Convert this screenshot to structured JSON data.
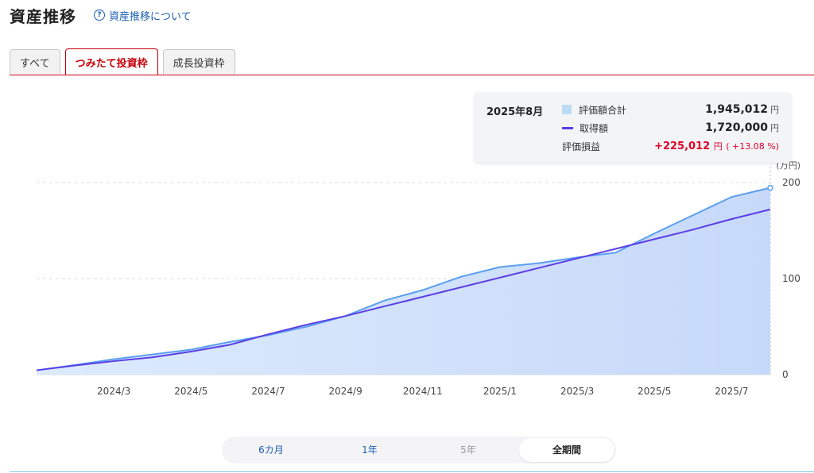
{
  "header": {
    "title": "資産推移",
    "help_link": "資産推移について",
    "help_icon": "question-circle-icon"
  },
  "tabs": [
    {
      "label": "すべて",
      "active": false
    },
    {
      "label": "つみたて投資枠",
      "active": true
    },
    {
      "label": "成長投資枠",
      "active": false
    }
  ],
  "tooltip": {
    "month": "2025年8月",
    "valuation_label": "評価額合計",
    "valuation_value": "1,945,012",
    "cost_label": "取得額",
    "cost_value": "1,720,000",
    "pnl_label": "評価損益",
    "pnl_value": "+225,012",
    "pnl_pct": "( +13.08 %)",
    "unit": "円"
  },
  "range": {
    "options": [
      "6カ月",
      "1年",
      "5年",
      "全期間"
    ],
    "active_index": 3,
    "disabled_index": 2
  },
  "colors": {
    "area_fill": "#cfe4fb",
    "valuation_line": "#5a9ef0",
    "cost_line": "#5b3ee6",
    "positive": "#e0002a",
    "accent": "#c7000b"
  },
  "chart_data": {
    "type": "area",
    "y_unit": "(万円)",
    "ylim": [
      0,
      200
    ],
    "y_ticks": [
      0,
      100,
      200
    ],
    "x_tick_labels": [
      "2024/3",
      "2024/5",
      "2024/7",
      "2024/9",
      "2024/11",
      "2025/1",
      "2025/3",
      "2025/5",
      "2025/7"
    ],
    "x": [
      "2024/1",
      "2024/2",
      "2024/3",
      "2024/4",
      "2024/5",
      "2024/6",
      "2024/7",
      "2024/8",
      "2024/9",
      "2024/10",
      "2024/11",
      "2024/12",
      "2025/1",
      "2025/2",
      "2025/3",
      "2025/4",
      "2025/5",
      "2025/6",
      "2025/7",
      "2025/8"
    ],
    "series": [
      {
        "name": "評価額合計",
        "kind": "area",
        "values": [
          4.5,
          10,
          16,
          21,
          26,
          34,
          41,
          50,
          61,
          77,
          88,
          102,
          112,
          116,
          122,
          127,
          147,
          166,
          185,
          194.5
        ]
      },
      {
        "name": "取得額",
        "kind": "line",
        "values": [
          4.5,
          9.5,
          14,
          18,
          24,
          31,
          42,
          52,
          61,
          71,
          81,
          91,
          101,
          111,
          121,
          131,
          141,
          151,
          162,
          172
        ]
      }
    ]
  }
}
